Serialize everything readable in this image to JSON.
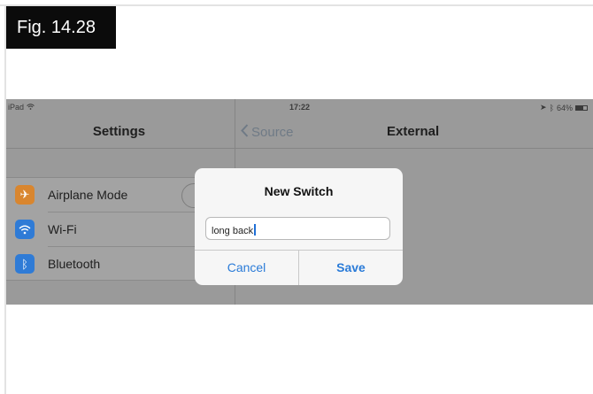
{
  "figure": {
    "label": "Fig. 14.28"
  },
  "status_bar": {
    "device": "iPad",
    "time": "17:22",
    "battery": "64%",
    "wifi_icon": "wifi-icon",
    "bluetooth_icon": "bluetooth-icon",
    "location_icon": "location-arrow-icon"
  },
  "master": {
    "title": "Settings",
    "items": [
      {
        "label": "Airplane Mode",
        "icon": "airplane-icon",
        "color": "#d9862f"
      },
      {
        "label": "Wi-Fi",
        "icon": "wifi-icon",
        "color": "#2f7bd6"
      },
      {
        "label": "Bluetooth",
        "icon": "bluetooth-icon",
        "color": "#2f7bd6"
      }
    ]
  },
  "detail": {
    "back_label": "Source",
    "title": "External"
  },
  "dialog": {
    "title": "New Switch",
    "input_value": "long back",
    "cancel_label": "Cancel",
    "save_label": "Save"
  },
  "colors": {
    "accent": "#2a7bd8",
    "dim_overlay": "#9a9a9a"
  }
}
